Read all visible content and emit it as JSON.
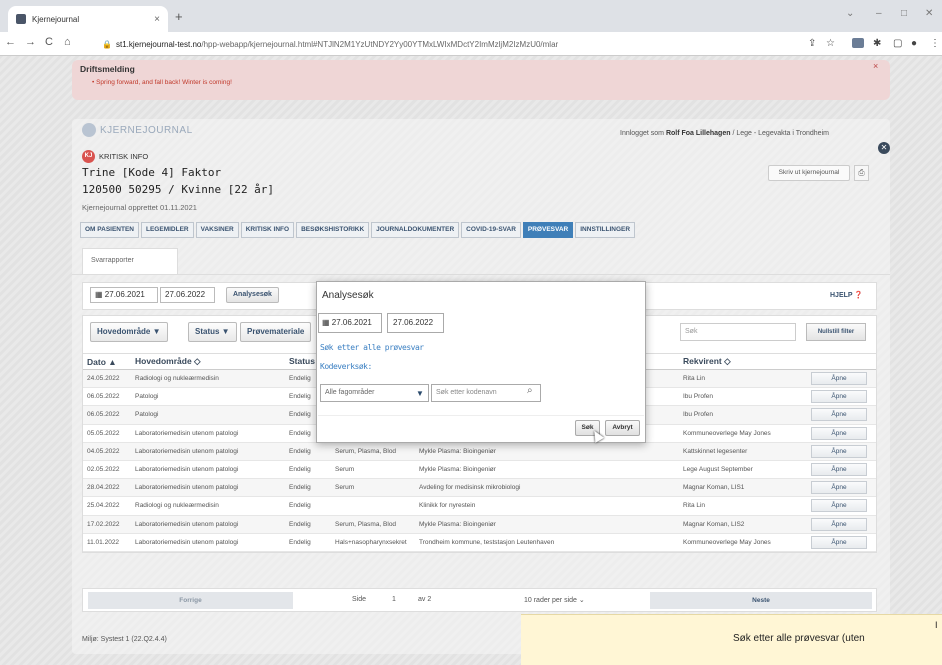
{
  "browser": {
    "tab_title": "Kjernejournal",
    "tab_close": "×",
    "new_tab": "+",
    "url_host": "st1.kjernejournal-test.no",
    "url_path": "/hpp-webapp/kjernejournal.html#NTJlN2M1YzUtNDY2Yy00YTMxLWIxMDctY2ImMzljM2IzMzU0/mlar",
    "win_min": "–",
    "win_max": "□",
    "win_close": "✕",
    "win_chev": "⌄",
    "back": "←",
    "forward": "→",
    "reload": "C",
    "home": "⌂"
  },
  "alert": {
    "title": "Driftsmelding",
    "message": "• Spring forward, and fall back! Winter is coming!",
    "close": "×"
  },
  "header": {
    "logo_text": "KJERNEJOURNAL",
    "logged_in_label": "Innlogget som",
    "logged_in_user": "Rolf Foa Lillehagen",
    "logged_in_role": "/ Lege - Legevakta i Trondheim",
    "close_icon": "✕",
    "kritisk_badge": "KJ",
    "kritisk_label": "KRITISK INFO",
    "patient_name": "Trine [Kode 4] Faktor",
    "patient_id": "120500 50295 / Kvinne [22 år]",
    "opprettet": "Kjernejournal opprettet 01.11.2021",
    "skriv_ut": "Skriv ut kjernejournal",
    "print_icon": "⎙"
  },
  "tabs": [
    "OM PASIENTEN",
    "LEGEMIDLER",
    "VAKSINER",
    "KRITISK INFO",
    "BESØKSHISTORIKK",
    "JOURNALDOKUMENTER",
    "COVID-19-SVAR",
    "PRØVESVAR",
    "INNSTILLINGER"
  ],
  "active_tab": "PRØVESVAR",
  "subtab": "Svarrapporter",
  "datebar": {
    "cal_icon": "▦",
    "from": "27.06.2021",
    "to": "27.06.2022",
    "analysesok_btn": "Analysesøk",
    "hjelp": "HJELP"
  },
  "filters": {
    "hovedomrade": "Hovedområde ▼",
    "status": "Status ▼",
    "provemateriale": "Prøvemateriale",
    "sok_placeholder": "Søk",
    "nullstill": "Nullstill filter"
  },
  "table": {
    "headers": [
      "Dato",
      "Hovedområde",
      "Status",
      "",
      "",
      "Rekvirent"
    ],
    "action_label": "Åpne",
    "rows": [
      [
        "24.05.2022",
        "Radiologi og nukleærmedisin",
        "Endelig",
        "",
        "",
        "Rita Lin"
      ],
      [
        "06.05.2022",
        "Patologi",
        "Endelig",
        "",
        "",
        "Ibu Profen"
      ],
      [
        "06.05.2022",
        "Patologi",
        "Endelig",
        "",
        "",
        "Ibu Profen"
      ],
      [
        "05.05.2022",
        "Laboratoriemedisin utenom patologi",
        "Endelig",
        "",
        "",
        "Kommuneoverlege May Jones"
      ],
      [
        "04.05.2022",
        "Laboratoriemedisin utenom patologi",
        "Endelig",
        "Serum, Plasma, Blod",
        "Mykle Plasma: Bioingeniør",
        "Kattskinnet legesenter"
      ],
      [
        "02.05.2022",
        "Laboratoriemedisin utenom patologi",
        "Endelig",
        "Serum",
        "Mykle Plasma: Bioingeniør",
        "Lege August September"
      ],
      [
        "28.04.2022",
        "Laboratoriemedisin utenom patologi",
        "Endelig",
        "Serum",
        "Avdeling for medisinsk mikrobiologi",
        "Magnar Koman, LIS1"
      ],
      [
        "25.04.2022",
        "Radiologi og nukleærmedisin",
        "Endelig",
        "",
        "Klinikk for nyrestein",
        "Rita Lin"
      ],
      [
        "17.02.2022",
        "Laboratoriemedisin utenom patologi",
        "Endelig",
        "Serum, Plasma, Blod",
        "Mykle Plasma: Bioingeniør",
        "Magnar Koman, LIS2"
      ],
      [
        "11.01.2022",
        "Laboratoriemedisin utenom patologi",
        "Endelig",
        "Hals+nasopharynxsekret",
        "Trondheim kommune, teststasjon Leutenhaven",
        "Kommuneoverlege May Jones"
      ]
    ]
  },
  "pager": {
    "forrige": "Forrige",
    "side_label": "Side",
    "page": "1",
    "of": "av 2",
    "rows_per_page": "10 rader per side",
    "neste": "Neste"
  },
  "footer": "Miljø: Systest 1 (22.Q2.4.4)",
  "modal": {
    "title": "Analysesøk",
    "cal_icon": "▦",
    "from": "27.06.2021",
    "to": "27.06.2022",
    "all_link": "Søk etter alle prøvesvar",
    "kodeverk_label": "Kodeverksøk:",
    "select_value": "Alle fagområder",
    "select_caret": "▼",
    "search_placeholder": "Søk etter kodenavn",
    "search_icon": "⌕",
    "sok_btn": "Søk",
    "avbryt_btn": "Avbryt"
  },
  "tooltip": {
    "letter": "I",
    "text": "Søk etter alle prøvesvar (uten"
  }
}
